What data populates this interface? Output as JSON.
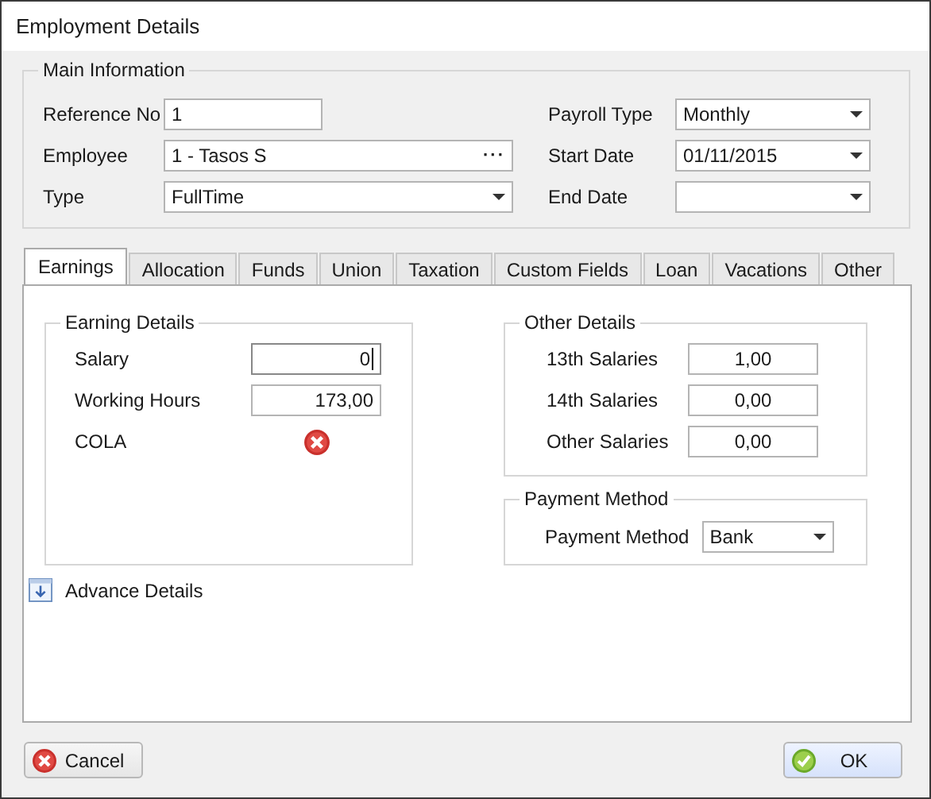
{
  "window": {
    "title": "Employment Details"
  },
  "main_information": {
    "title": "Main Information",
    "left_fields": [
      {
        "label": "Reference No",
        "kind": "text",
        "value": "1"
      },
      {
        "label": "Employee",
        "kind": "lookup",
        "value": "1 - Tasos S",
        "button": "···"
      },
      {
        "label": "Type",
        "kind": "dropdown",
        "value": "FullTime"
      }
    ],
    "right_fields": [
      {
        "label": "Payroll Type",
        "kind": "dropdown",
        "value": "Monthly"
      },
      {
        "label": "Start Date",
        "kind": "dropdown",
        "value": "01/11/2015"
      },
      {
        "label": "End Date",
        "kind": "dropdown"
      }
    ]
  },
  "tabs": [
    {
      "label": "Earnings",
      "selected": true
    },
    {
      "label": "Allocation",
      "selected": false
    },
    {
      "label": "Funds",
      "selected": false
    },
    {
      "label": "Union",
      "selected": false
    },
    {
      "label": "Taxation",
      "selected": false
    },
    {
      "label": "Custom Fields",
      "selected": false
    },
    {
      "label": "Loan",
      "selected": false
    },
    {
      "label": "Vacations",
      "selected": false
    },
    {
      "label": "Other",
      "selected": false
    }
  ],
  "earning_details": {
    "title": "Earning Details",
    "fields": [
      {
        "label": "Salary",
        "kind": "number",
        "value": "0",
        "focused": true
      },
      {
        "label": "Working Hours",
        "kind": "number",
        "value": "173,00",
        "focused": false
      },
      {
        "label": "COLA",
        "kind": "flag",
        "checked": false
      }
    ]
  },
  "other_details": {
    "title": "Other Details",
    "fields": [
      {
        "label": "13th Salaries",
        "value": "1,00"
      },
      {
        "label": "14th Salaries",
        "value": "0,00"
      },
      {
        "label": "Other Salaries",
        "value": "0,00"
      }
    ]
  },
  "payment_method": {
    "title": "Payment Method",
    "label": "Payment Method",
    "value": "Bank"
  },
  "advance_details": {
    "label": "Advance Details",
    "expanded": false
  },
  "buttons": [
    {
      "label": "Cancel",
      "kind": "cancel"
    },
    {
      "label": "OK",
      "kind": "ok"
    }
  ]
}
